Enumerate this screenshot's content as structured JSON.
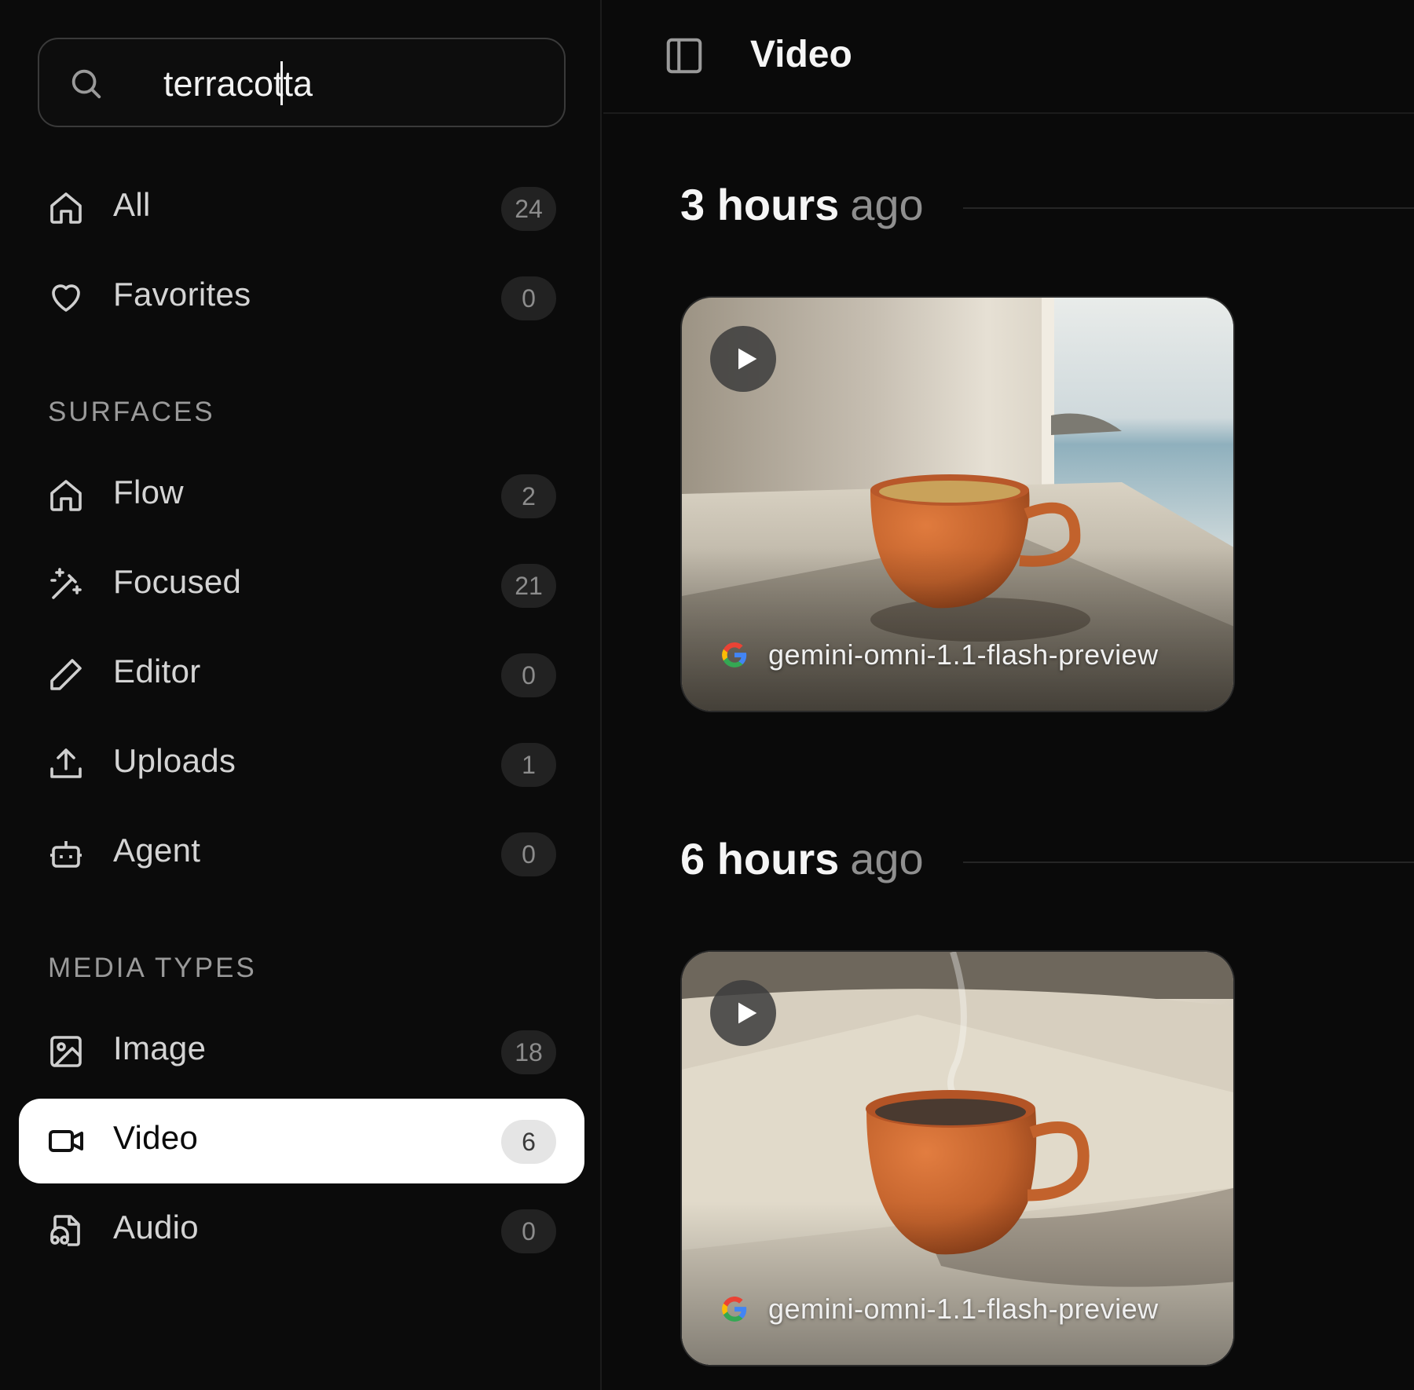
{
  "search": {
    "value": "terracotta"
  },
  "nav": {
    "top": [
      {
        "label": "All",
        "count": "24",
        "icon": "home-icon"
      },
      {
        "label": "Favorites",
        "count": "0",
        "icon": "heart-icon"
      }
    ],
    "surfaces_label": "SURFACES",
    "surfaces": [
      {
        "label": "Flow",
        "count": "2",
        "icon": "home-icon"
      },
      {
        "label": "Focused",
        "count": "21",
        "icon": "magic-wand-icon"
      },
      {
        "label": "Editor",
        "count": "0",
        "icon": "pencil-icon"
      },
      {
        "label": "Uploads",
        "count": "1",
        "icon": "upload-icon"
      },
      {
        "label": "Agent",
        "count": "0",
        "icon": "robot-icon"
      }
    ],
    "media_label": "MEDIA TYPES",
    "media": [
      {
        "label": "Image",
        "count": "18",
        "icon": "image-icon"
      },
      {
        "label": "Video",
        "count": "6",
        "icon": "video-icon",
        "active": true
      },
      {
        "label": "Audio",
        "count": "0",
        "icon": "audio-file-icon"
      }
    ]
  },
  "header": {
    "title": "Video",
    "icon": "sidebar-toggle-icon"
  },
  "groups": [
    {
      "time": "3 hours",
      "suffix": "ago",
      "card": {
        "model": "gemini-omni-1.1-flash-preview",
        "icon": "google-icon"
      }
    },
    {
      "time": "6 hours",
      "suffix": "ago",
      "card": {
        "model": "gemini-omni-1.1-flash-preview",
        "icon": "google-icon"
      }
    }
  ],
  "colors": {
    "background": "#0a0a0a",
    "active_item": "#ffffff",
    "cup": "#c2622c"
  }
}
